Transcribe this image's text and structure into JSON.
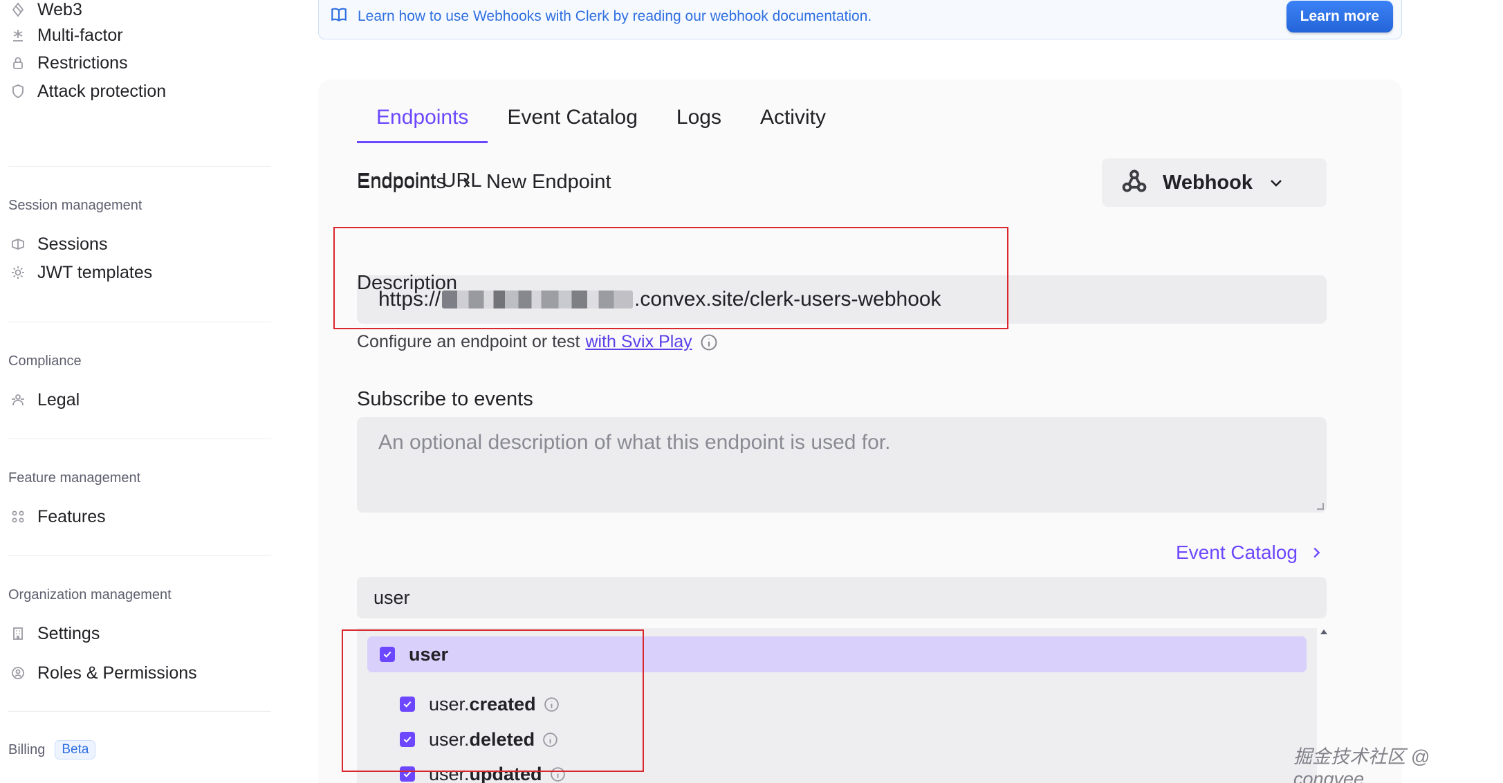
{
  "sidebar": {
    "top_items": [
      {
        "label": "Web3",
        "icon": "web3-icon"
      },
      {
        "label": "Multi-factor",
        "icon": "asterisk-icon"
      },
      {
        "label": "Restrictions",
        "icon": "lock-icon"
      },
      {
        "label": "Attack protection",
        "icon": "shield-icon"
      }
    ],
    "sections": {
      "session": {
        "title": "Session management",
        "items": [
          "Sessions",
          "JWT templates"
        ]
      },
      "compliance": {
        "title": "Compliance",
        "items": [
          "Legal"
        ]
      },
      "feature": {
        "title": "Feature management",
        "items": [
          "Features"
        ]
      },
      "organization": {
        "title": "Organization management",
        "items": [
          "Settings",
          "Roles & Permissions"
        ]
      },
      "billing": {
        "title": "Billing",
        "badge": "Beta"
      }
    }
  },
  "banner": {
    "text": "Learn how to use Webhooks with Clerk by reading our webhook documentation.",
    "button": "Learn more",
    "icon": "book-icon"
  },
  "tabs": [
    {
      "label": "Endpoints",
      "active": true
    },
    {
      "label": "Event Catalog",
      "active": false
    },
    {
      "label": "Logs",
      "active": false
    },
    {
      "label": "Activity",
      "active": false
    }
  ],
  "breadcrumb": {
    "parent": "Endpoints",
    "current": "New Endpoint"
  },
  "webhook_selector": {
    "label": "Webhook",
    "icon": "webhook-icon"
  },
  "form": {
    "endpoint_url": {
      "label": "Endpoint URL",
      "value_prefix": "https://",
      "value_suffix": ".convex.site/clerk-users-webhook"
    },
    "helper": {
      "text": "Configure an endpoint or test",
      "link": "with Svix Play"
    },
    "description": {
      "label": "Description",
      "placeholder": "An optional description of what this endpoint is used for."
    },
    "events": {
      "label": "Subscribe to events",
      "catalog_link": "Event Catalog",
      "filter_value": "user",
      "group": {
        "label": "user",
        "checked": true
      },
      "items": [
        {
          "prefix": "user.",
          "name": "created",
          "checked": true
        },
        {
          "prefix": "user.",
          "name": "deleted",
          "checked": true
        },
        {
          "prefix": "user.",
          "name": "updated",
          "checked": true
        }
      ]
    }
  },
  "colors": {
    "accent": "#6c47ff",
    "link_blue": "#2f6fe0",
    "annotation_red": "#d9272e"
  },
  "watermark": "掘金技术社区 @ congvee"
}
